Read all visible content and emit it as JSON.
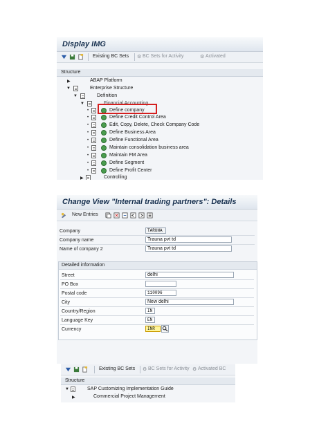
{
  "display_img": {
    "title": "Display IMG",
    "toolbar": {
      "existing_bc_sets": "Existing BC Sets",
      "bc_sets_for_activity": "BC Sets for Activity",
      "activated": "Activated"
    },
    "structure_header": "Structure",
    "tree": [
      {
        "label": "ABAP Platform"
      },
      {
        "label": "Enterprise Structure"
      },
      {
        "label": "Definition"
      },
      {
        "label": "Financial Accounting"
      },
      {
        "label": "Define company"
      },
      {
        "label": "Define Credit Control Area"
      },
      {
        "label": "Edit, Copy, Delete, Check Company Code"
      },
      {
        "label": "Define Business Area"
      },
      {
        "label": "Define Functional Area"
      },
      {
        "label": "Maintain consolidation business area"
      },
      {
        "label": "Maintain FM Area"
      },
      {
        "label": "Define Segment"
      },
      {
        "label": "Define Profit Center"
      },
      {
        "label": "Controlling"
      }
    ]
  },
  "change_view": {
    "title": "Change View \"Internal trading partners\": Details",
    "new_entries": "New Entries",
    "company": {
      "label": "Company",
      "value": "TARUNA"
    },
    "company_name": {
      "label": "Company name",
      "value": "Trauna pvt td"
    },
    "company_name2": {
      "label": "Name of company 2",
      "value": "Trauna pvt td"
    },
    "detailed_header": "Detailed information",
    "street": {
      "label": "Street",
      "value": "delhi"
    },
    "po_box": {
      "label": "PO Box",
      "value": ""
    },
    "postal_code": {
      "label": "Postal code",
      "value": "110096"
    },
    "city": {
      "label": "City",
      "value": "New delhi"
    },
    "country": {
      "label": "Country/Region",
      "value": "IN"
    },
    "language": {
      "label": "Language Key",
      "value": "EN"
    },
    "currency": {
      "label": "Currency",
      "value": "INR"
    }
  },
  "bottom": {
    "toolbar": {
      "existing_bc_sets": "Existing BC Sets",
      "bc_sets_for_activity": "BC Sets for Activity",
      "activated": "Activated BC"
    },
    "structure_header": "Structure",
    "tree": [
      {
        "label": "SAP Customizing Implementation Guide"
      },
      {
        "label": "Commercial Project Management"
      }
    ]
  },
  "colors": {
    "highlight_box": "#d41f1f",
    "title_text": "#17304f",
    "currency_fill": "#fff59a"
  },
  "icons": [
    "tree-expand-icon",
    "save-icon",
    "document-icon",
    "bc-set-icon",
    "clock-activity-icon",
    "new-entries-icon",
    "search-help-icon"
  ]
}
